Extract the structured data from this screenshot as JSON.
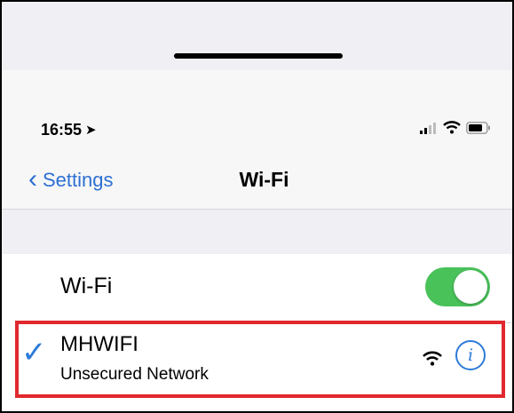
{
  "status_bar": {
    "time": "16:55",
    "location_icon": "location-arrow-icon",
    "icons": [
      "cellular-signal-icon",
      "wifi-icon",
      "battery-icon"
    ]
  },
  "nav_bar": {
    "back_label": "Settings",
    "title": "Wi-Fi"
  },
  "wifi_toggle": {
    "label": "Wi-Fi",
    "on": true,
    "on_color": "#49c25a"
  },
  "current_network": {
    "ssid": "MHWIFI",
    "security": "Unsecured Network",
    "connected": true,
    "signal_icon": "wifi-signal-icon",
    "info_icon": "info-icon",
    "info_glyph": "i"
  },
  "colors": {
    "accent": "#2d7bd9",
    "highlight": "#e0282e"
  }
}
